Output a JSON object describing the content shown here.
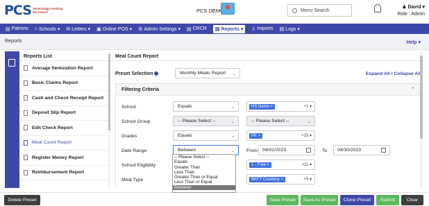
{
  "header": {
    "logo_mark": "PCS",
    "logo_tagline": "Technology Feeding the Future",
    "app_title": "PCS DEMO",
    "search_placeholder": "Menu Search",
    "user_name": "David",
    "user_role": "Role : Admin"
  },
  "nav": {
    "items": [
      {
        "icon": "▤",
        "label": "Patrons"
      },
      {
        "icon": "⌂",
        "label": "Schools ▾"
      },
      {
        "icon": "✉",
        "label": "Letters ▾"
      },
      {
        "icon": "▣",
        "label": "Online POS ▾"
      },
      {
        "icon": "⚙",
        "label": "Admin Settings ▾"
      },
      {
        "icon": "▤",
        "label": "CRCR"
      },
      {
        "icon": "▤",
        "label": "Reports ▾"
      },
      {
        "icon": "⇩",
        "label": "Imports"
      },
      {
        "icon": "▤",
        "label": "Logs ▾"
      }
    ]
  },
  "breadcrumb": "Reports",
  "help_label": "Help ▾",
  "reports_list": {
    "title": "Reports List",
    "items": [
      "Average Itemization Report",
      "Basic Claims Report",
      "Cash and Check Receipt Report",
      "Deposit Slip Report",
      "Edit Check Report",
      "Meal Count Report",
      "Register Money Report",
      "Reimbursement Report"
    ],
    "active_index": 5
  },
  "main": {
    "title": "Meal Count Report",
    "preset_label": "Preset Selection",
    "preset_value": "Monthly Meals Report",
    "expand_label": "Expand All / Collapse All",
    "criteria_title": "Filtering Criteria",
    "rows": {
      "school": {
        "label": "School",
        "op": "Equals",
        "chip": "HS Demo ×",
        "more": "+1 ▾"
      },
      "school_group": {
        "label": "School Group",
        "op": "-- Please Select --",
        "value": "-- Please Select --"
      },
      "grades": {
        "label": "Grades",
        "op": "Equals",
        "chip": "PK ×",
        "more": "+15 ▾"
      },
      "date_range": {
        "label": "Date Range",
        "op": "Between",
        "from_label": "From",
        "from": "04/01/2023",
        "to_label": "To",
        "to": "04/30/2023"
      },
      "eligibility": {
        "label": "School Eligibility",
        "chip": "1 - Free ×",
        "more": "+11 ▾"
      },
      "meal_type": {
        "label": "Meal Type",
        "chip": "BKFT Courtesy ×",
        "more": "+5 ▾"
      }
    },
    "dropdown_options": [
      "-- Please Select --",
      "Equals",
      "Greater Than",
      "Less Than",
      "Greater Than or Equal",
      "Less Than or Equal",
      "Between"
    ],
    "dropdown_selected_index": 6
  },
  "footer": {
    "delete_preset": "Delete Preset",
    "save_preset": "Save Preset",
    "save_as_preset": "Save As Preset",
    "clone_preset": "Clone Preset",
    "submit": "Submit",
    "clear": "Clear"
  },
  "colors": {
    "nav_bg": "#3f48a8",
    "chip": "#3f6fe0",
    "green": "#5cb85c",
    "dark": "#3e3e3e"
  }
}
